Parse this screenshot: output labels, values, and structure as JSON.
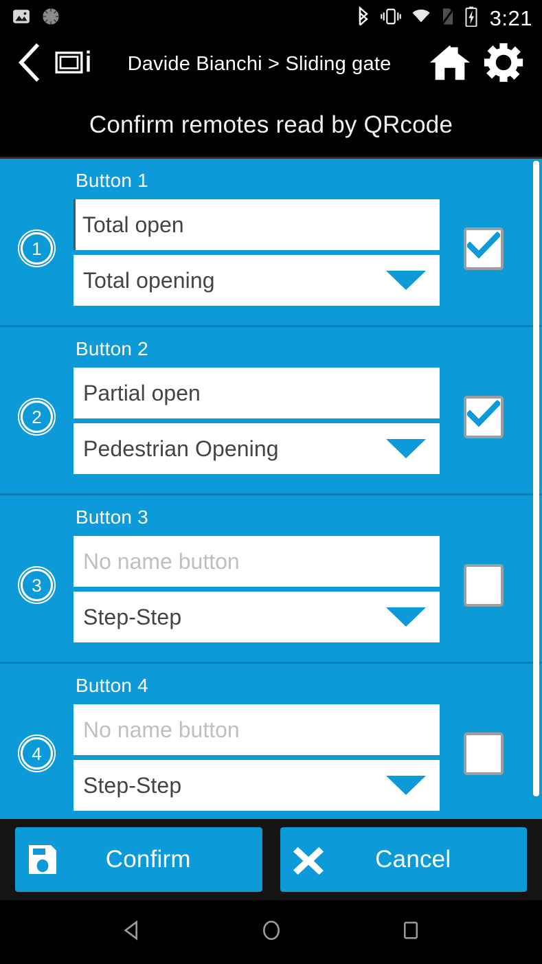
{
  "status_bar": {
    "left_icons": [
      "screenshot-image-icon",
      "brightness-icon"
    ],
    "right_icons": [
      "bluetooth-icon",
      "vibrate-icon",
      "wifi-icon",
      "no-sim-icon",
      "battery-charging-icon"
    ],
    "time": "3:21"
  },
  "nav_bar": {
    "back_icon": "chevron-left-icon",
    "device_icon": "remote-info-icon",
    "breadcrumb": "Davide Bianchi > Sliding gate",
    "home_icon": "home-icon",
    "settings_icon": "gear-icon"
  },
  "page": {
    "title": "Confirm remotes read by QRcode"
  },
  "colors": {
    "accent": "#0c9ad9",
    "divider": "#0b7fb3",
    "action_bar_bg": "#141414",
    "header_bg": "#000000",
    "field_bg": "#ffffff",
    "field_text": "#444444",
    "placeholder": "#bfbfbf",
    "checkbox_border": "#9e9e9e"
  },
  "rows": [
    {
      "badge": "1",
      "label": "Button 1",
      "name_value": "Total open",
      "name_placeholder": "No name button",
      "has_caret": true,
      "function_value": "Total opening",
      "checked": true
    },
    {
      "badge": "2",
      "label": "Button 2",
      "name_value": "Partial open",
      "name_placeholder": "No name button",
      "has_caret": false,
      "function_value": "Pedestrian Opening",
      "checked": true
    },
    {
      "badge": "3",
      "label": "Button 3",
      "name_value": "",
      "name_placeholder": "No name button",
      "has_caret": false,
      "function_value": "Step-Step",
      "checked": false
    },
    {
      "badge": "4",
      "label": "Button 4",
      "name_value": "",
      "name_placeholder": "No name button",
      "has_caret": false,
      "function_value": "Step-Step",
      "checked": false
    }
  ],
  "actions": {
    "confirm_label": "Confirm",
    "confirm_icon": "save-floppy-icon",
    "cancel_label": "Cancel",
    "cancel_icon": "close-x-icon"
  },
  "android_nav": {
    "back_icon": "triangle-back-icon",
    "home_icon": "circle-home-icon",
    "recents_icon": "square-recents-icon"
  }
}
